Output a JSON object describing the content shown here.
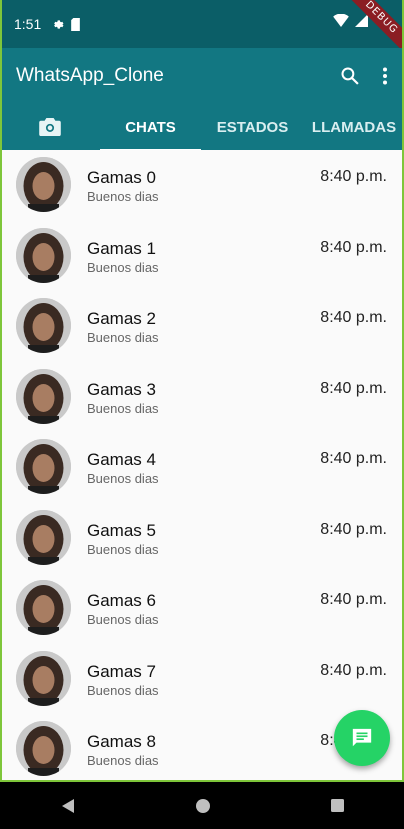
{
  "status_bar": {
    "time": "1:51",
    "debug_label": "DEBUG"
  },
  "app_bar": {
    "title": "WhatsApp_Clone",
    "search_icon": "search-icon",
    "menu_icon": "more-vert-icon"
  },
  "tabs": [
    {
      "label": "",
      "icon": "camera-icon"
    },
    {
      "label": "CHATS"
    },
    {
      "label": "ESTADOS"
    },
    {
      "label": "LLAMADAS"
    }
  ],
  "chats": [
    {
      "name": "Gamas 0",
      "message": "Buenos dias",
      "time": "8:40 p.m."
    },
    {
      "name": "Gamas 1",
      "message": "Buenos dias",
      "time": "8:40 p.m."
    },
    {
      "name": "Gamas 2",
      "message": "Buenos dias",
      "time": "8:40 p.m."
    },
    {
      "name": "Gamas 3",
      "message": "Buenos dias",
      "time": "8:40 p.m."
    },
    {
      "name": "Gamas 4",
      "message": "Buenos dias",
      "time": "8:40 p.m."
    },
    {
      "name": "Gamas 5",
      "message": "Buenos dias",
      "time": "8:40 p.m."
    },
    {
      "name": "Gamas 6",
      "message": "Buenos dias",
      "time": "8:40 p.m."
    },
    {
      "name": "Gamas 7",
      "message": "Buenos dias",
      "time": "8:40 p.m."
    },
    {
      "name": "Gamas 8",
      "message": "Buenos dias",
      "time": "8:40 p.m."
    }
  ],
  "fab": {
    "icon": "message-icon"
  },
  "colors": {
    "status_bar": "#0b5e67",
    "app_bar": "#127782",
    "fab": "#25d366"
  }
}
